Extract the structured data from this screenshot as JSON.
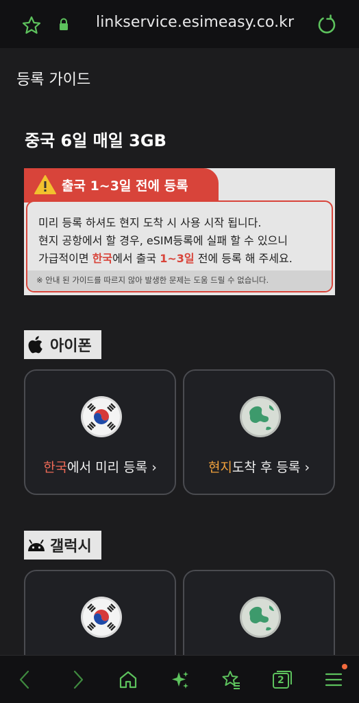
{
  "browser": {
    "url": "linkservice.esimeasy.co.kr"
  },
  "page": {
    "title": "등록 가이드",
    "plan_title": "중국 6일 매일 3GB"
  },
  "notice": {
    "tab_text": "출국 1~3일 전에 등록",
    "line1": "미리 등록 하셔도 현지 도착 시 사용 시작 됩니다.",
    "line2": "현지 공항에서 할 경우, eSIM등록에 실패 할 수 있으니",
    "line3_a": "가급적이면 ",
    "line3_hl1": "한국",
    "line3_b": "에서 출국 ",
    "line3_hl2": "1~3일",
    "line3_c": " 전에 등록 해 주세요.",
    "footer": "※ 안내 된 가이드를 따르지 않아 발생한 문제는 도움 드릴 수 없습니다.",
    "accent_color": "#d8443a"
  },
  "sections": {
    "iphone": {
      "label": "아이폰",
      "icon": "apple-icon",
      "cards": [
        {
          "accent": "한국",
          "rest": "에서 미리 등록",
          "arrow": "›",
          "icon": "korea-flag-icon"
        },
        {
          "accent": "현지",
          "rest": "도착 후 등록",
          "arrow": "›",
          "icon": "globe-icon"
        }
      ]
    },
    "galaxy": {
      "label": "갤럭시",
      "icon": "android-icon",
      "cards": [
        {
          "icon": "korea-flag-icon"
        },
        {
          "icon": "globe-icon"
        }
      ]
    }
  },
  "bottom_nav": {
    "tab_count": "2",
    "icons": [
      "back-icon",
      "forward-icon",
      "home-icon",
      "ai-sparkle-icon",
      "bookmarks-icon",
      "tabs-icon",
      "menu-icon"
    ]
  }
}
